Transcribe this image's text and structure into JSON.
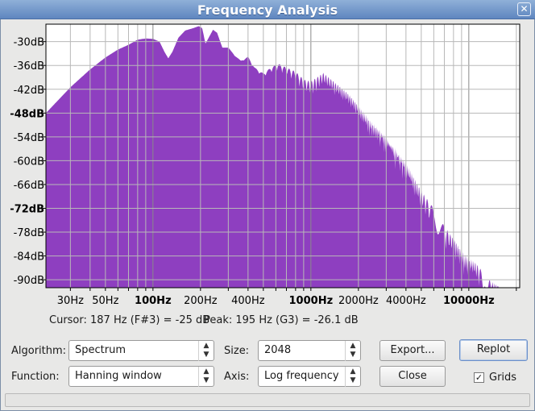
{
  "window": {
    "title": "Frequency Analysis",
    "close_glyph": "✕",
    "close_icon": "close-icon"
  },
  "chart_data": {
    "type": "area",
    "color": "#8e3fc0",
    "grid": true,
    "x_scale": "log",
    "xlim": [
      21,
      21000
    ],
    "ylim": [
      -92,
      -25.6
    ],
    "y_ticks": [
      {
        "label": "-30dB",
        "value": -30,
        "bold": false
      },
      {
        "label": "-36dB",
        "value": -36,
        "bold": false
      },
      {
        "label": "-42dB",
        "value": -42,
        "bold": false
      },
      {
        "label": "-48dB",
        "value": -48,
        "bold": true
      },
      {
        "label": "-54dB",
        "value": -54,
        "bold": false
      },
      {
        "label": "-60dB",
        "value": -60,
        "bold": false
      },
      {
        "label": "-66dB",
        "value": -66,
        "bold": false
      },
      {
        "label": "-72dB",
        "value": -72,
        "bold": true
      },
      {
        "label": "-78dB",
        "value": -78,
        "bold": false
      },
      {
        "label": "-84dB",
        "value": -84,
        "bold": false
      },
      {
        "label": "-90dB",
        "value": -90,
        "bold": false
      }
    ],
    "x_ticks": [
      {
        "label": "30Hz",
        "value": 30,
        "bold": false
      },
      {
        "label": "50Hz",
        "value": 50,
        "bold": false
      },
      {
        "label": "100Hz",
        "value": 100,
        "bold": true
      },
      {
        "label": "200Hz",
        "value": 200,
        "bold": false
      },
      {
        "label": "400Hz",
        "value": 400,
        "bold": false
      },
      {
        "label": "1000Hz",
        "value": 1000,
        "bold": true
      },
      {
        "label": "2000Hz",
        "value": 2000,
        "bold": false
      },
      {
        "label": "4000Hz",
        "value": 4000,
        "bold": false
      },
      {
        "label": "10000Hz",
        "value": 10000,
        "bold": true
      }
    ],
    "spectrum": [
      [
        21,
        -48
      ],
      [
        30,
        -41.5
      ],
      [
        40,
        -37
      ],
      [
        50,
        -34
      ],
      [
        60,
        -32
      ],
      [
        70,
        -30.8
      ],
      [
        80,
        -29.5
      ],
      [
        90,
        -29.2
      ],
      [
        100,
        -29.3
      ],
      [
        110,
        -30
      ],
      [
        118,
        -32.5
      ],
      [
        125,
        -34.2
      ],
      [
        133,
        -32.5
      ],
      [
        145,
        -29
      ],
      [
        160,
        -27.2
      ],
      [
        180,
        -26.6
      ],
      [
        195,
        -26.1
      ],
      [
        205,
        -26.6
      ],
      [
        215,
        -30.5
      ],
      [
        222,
        -29.5
      ],
      [
        240,
        -27
      ],
      [
        255,
        -27.8
      ],
      [
        275,
        -31.5
      ],
      [
        300,
        -31.5
      ],
      [
        330,
        -33.5
      ],
      [
        360,
        -34.8
      ],
      [
        400,
        -33.8
      ],
      [
        440,
        -36.5
      ],
      [
        500,
        -38
      ],
      [
        560,
        -36.5
      ],
      [
        620,
        -35.5
      ],
      [
        700,
        -36.5
      ],
      [
        800,
        -37.5
      ],
      [
        900,
        -39.5
      ],
      [
        1000,
        -40
      ],
      [
        1200,
        -37.8
      ],
      [
        1400,
        -40
      ],
      [
        1700,
        -42.8
      ],
      [
        2000,
        -46
      ],
      [
        2400,
        -50
      ],
      [
        2800,
        -52.5
      ],
      [
        3300,
        -56
      ],
      [
        4000,
        -60.5
      ],
      [
        5000,
        -67.5
      ],
      [
        6000,
        -72
      ],
      [
        7000,
        -76.5
      ],
      [
        8000,
        -79.5
      ],
      [
        9000,
        -82.5
      ],
      [
        10000,
        -84.5
      ],
      [
        11000,
        -85.5
      ],
      [
        12000,
        -87.5
      ],
      [
        13000,
        -89.5
      ],
      [
        14000,
        -90.5
      ],
      [
        15500,
        -91.5
      ],
      [
        16500,
        -92
      ]
    ]
  },
  "readout": {
    "cursor": "Cursor: 187 Hz (F#3) = -25 dB",
    "peak": "Peak: 195 Hz (G3) = -26.1 dB"
  },
  "controls": {
    "algorithm_label": "Algorithm:",
    "algorithm_value": "Spectrum",
    "size_label": "Size:",
    "size_value": "2048",
    "function_label": "Function:",
    "function_value": "Hanning window",
    "axis_label": "Axis:",
    "axis_value": "Log frequency",
    "export_button": "Export...",
    "replot_button": "Replot",
    "close_button": "Close",
    "grids_label": "Grids",
    "grids_checked": true,
    "dropdown_icon": "up-down-arrows-icon"
  }
}
